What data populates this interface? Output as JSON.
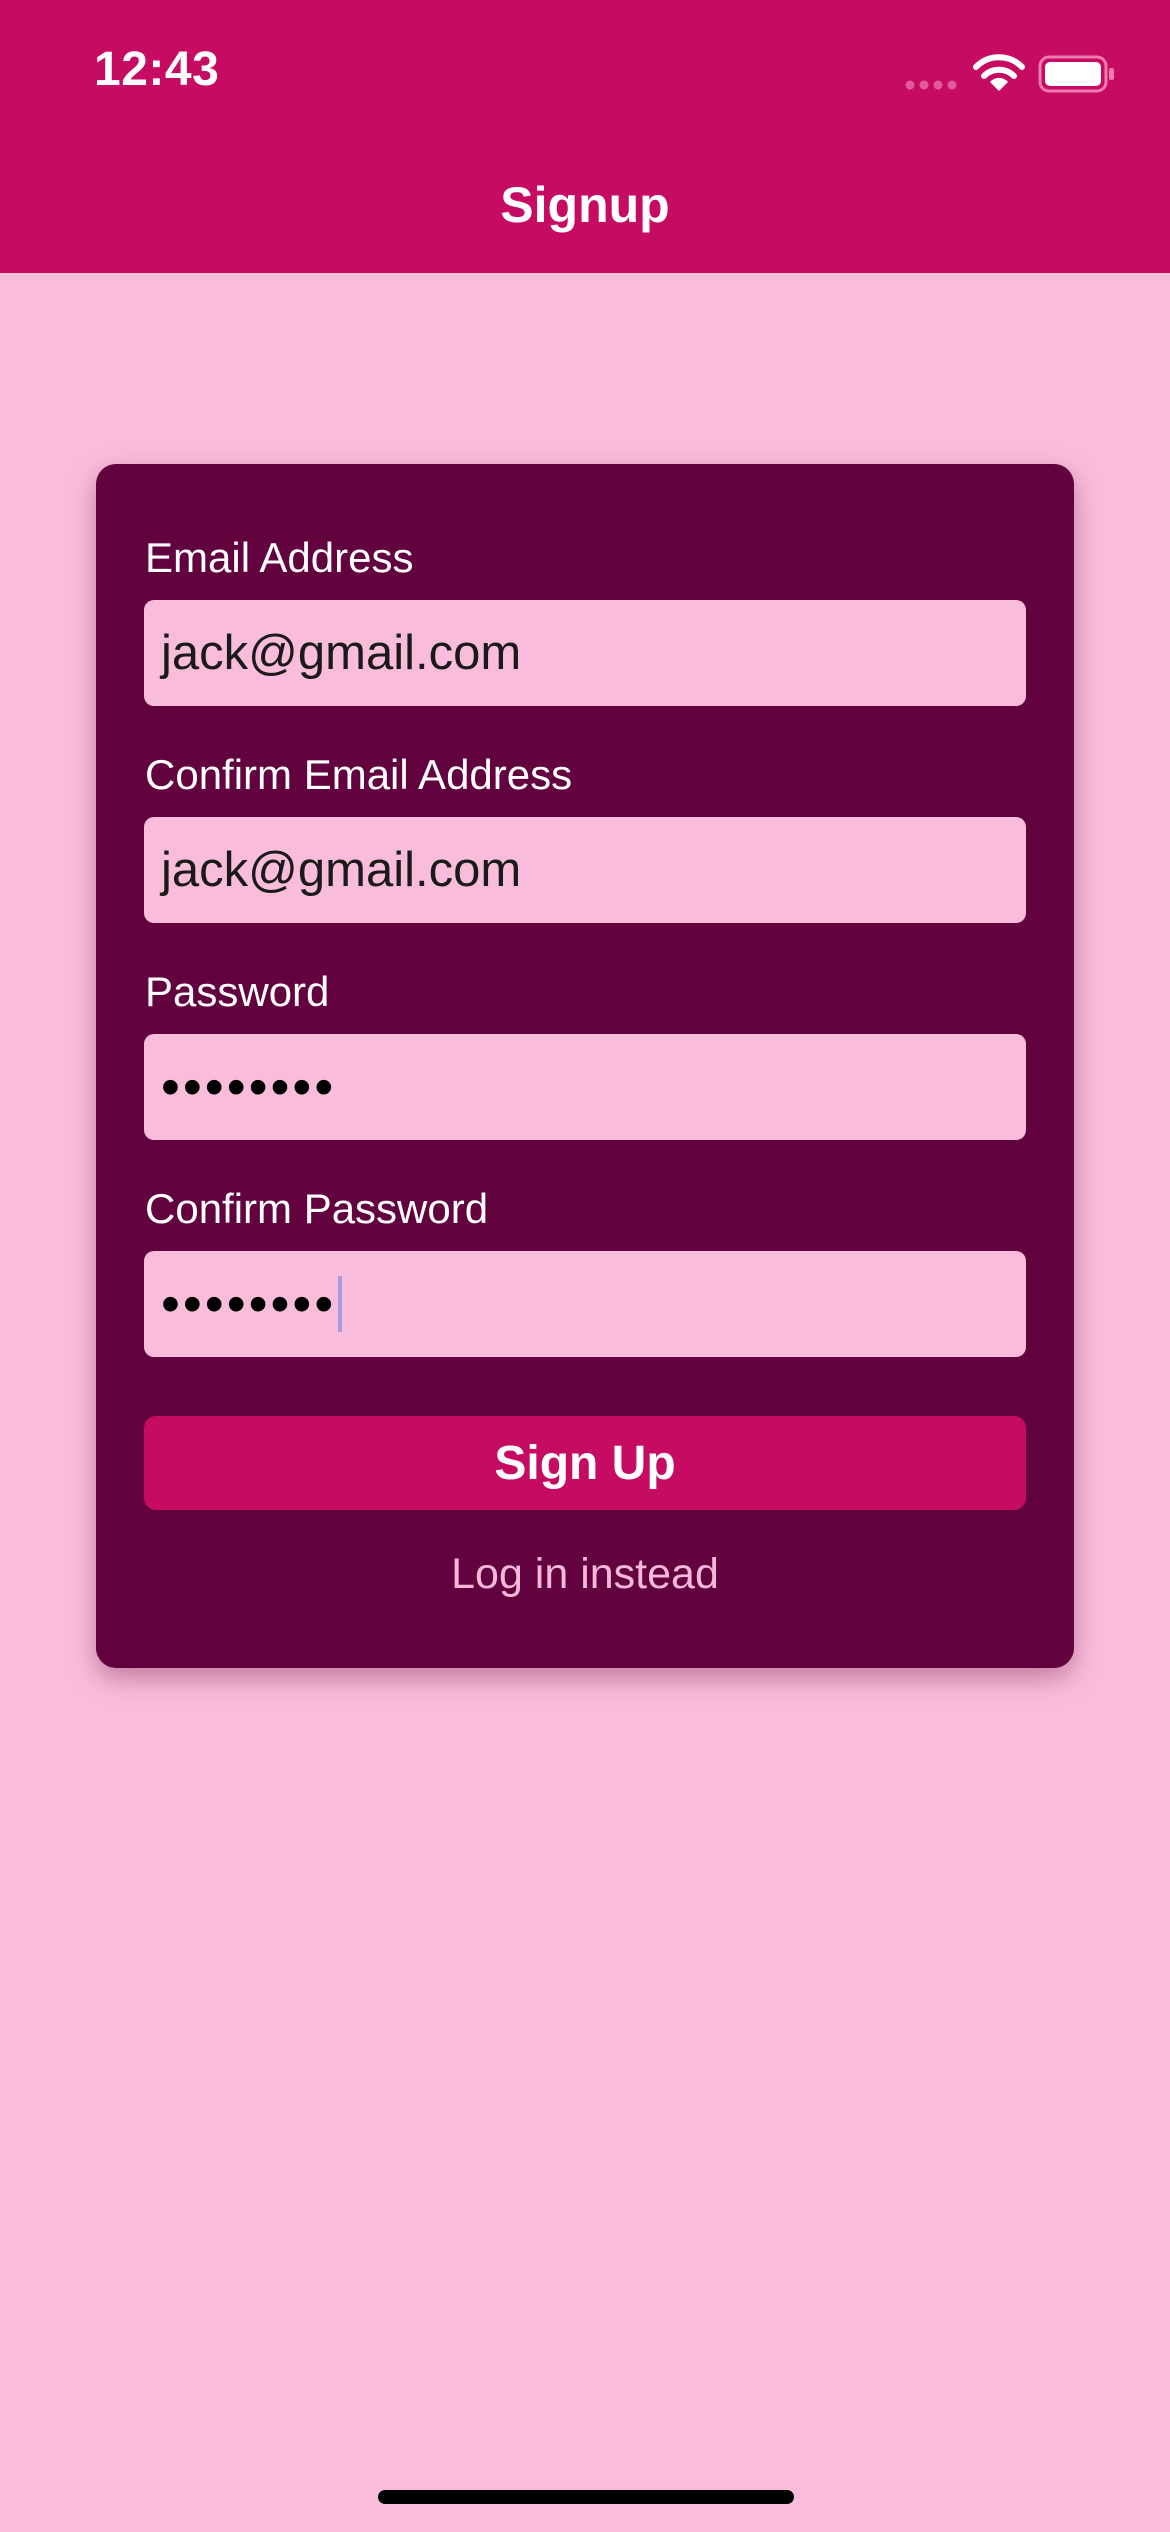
{
  "status_bar": {
    "time": "12:43"
  },
  "header": {
    "title": "Signup"
  },
  "form": {
    "email": {
      "label": "Email Address",
      "value": "jack@gmail.com"
    },
    "confirm_email": {
      "label": "Confirm Email Address",
      "value": "jack@gmail.com"
    },
    "password": {
      "label": "Password",
      "masked_value": "••••••••"
    },
    "confirm_password": {
      "label": "Confirm Password",
      "masked_value": "••••••••"
    },
    "submit_label": "Sign Up",
    "alternate_label": "Log in instead"
  },
  "icons": {
    "signal": "cellular-signal-icon",
    "wifi": "wifi-icon",
    "battery": "battery-icon"
  },
  "colors": {
    "primary": "#c60b62",
    "background": "#f9bddb",
    "card": "#62023f",
    "text_light": "#ffffff",
    "link": "#f5b8d8",
    "cursor": "#a99ae0"
  }
}
